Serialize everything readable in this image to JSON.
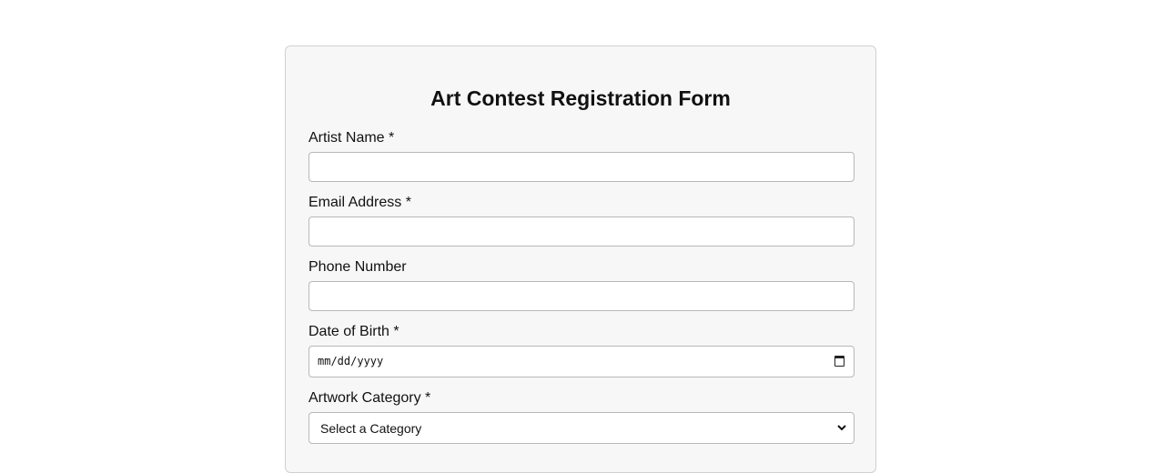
{
  "form": {
    "title": "Art Contest Registration Form",
    "fields": {
      "artist_name": {
        "label": "Artist Name *",
        "value": ""
      },
      "email": {
        "label": "Email Address *",
        "value": ""
      },
      "phone": {
        "label": "Phone Number",
        "value": ""
      },
      "dob": {
        "label": "Date of Birth *",
        "placeholder": "mm/dd/yyyy",
        "icon": "calendar-icon"
      },
      "category": {
        "label": "Artwork Category *",
        "selected": "Select a Category",
        "icon": "chevron-down-icon"
      }
    }
  },
  "colors": {
    "page_background": "#ffffff",
    "card_background": "#f7f7f7",
    "card_border": "#d0d0d0",
    "input_border": "#b8b8b8",
    "text": "#111111"
  }
}
